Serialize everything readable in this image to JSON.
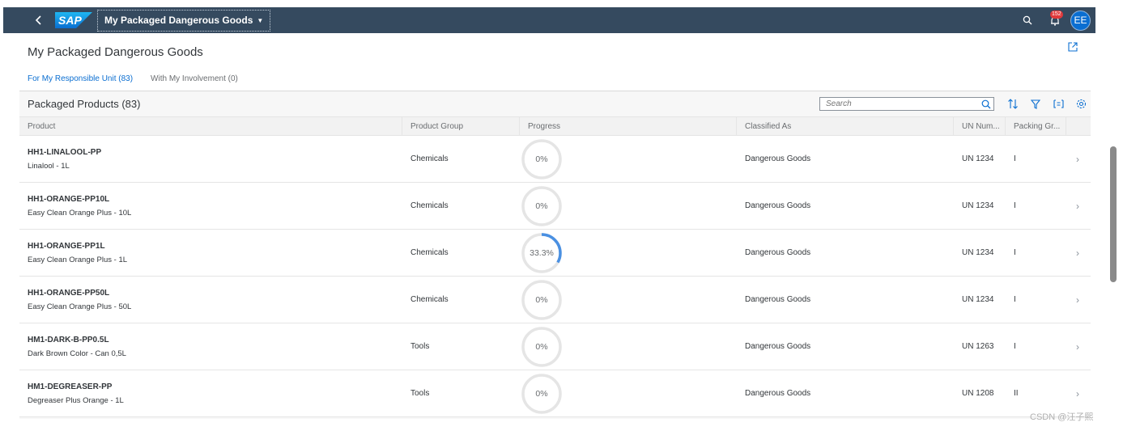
{
  "shell": {
    "title": "My Packaged Dangerous Goods",
    "logo_text": "SAP",
    "notification_count": "152",
    "avatar_initials": "EE"
  },
  "page": {
    "title": "My Packaged Dangerous Goods",
    "tabs": [
      {
        "label": "For My Responsible Unit (83)",
        "active": true
      },
      {
        "label": "With My Involvement (0)",
        "active": false
      }
    ]
  },
  "table": {
    "title": "Packaged Products (83)",
    "search_placeholder": "Search",
    "columns": [
      "Product",
      "Product Group",
      "Progress",
      "Classified As",
      "UN Num...",
      "Packing Gr..."
    ],
    "rows": [
      {
        "id": "HH1-LINALOOL-PP",
        "desc": "Linalool - 1L",
        "group": "Chemicals",
        "progress_label": "0%",
        "progress": 0,
        "classified": "Dangerous Goods",
        "un": "UN 1234",
        "packing": "I"
      },
      {
        "id": "HH1-ORANGE-PP10L",
        "desc": "Easy Clean Orange Plus - 10L",
        "group": "Chemicals",
        "progress_label": "0%",
        "progress": 0,
        "classified": "Dangerous Goods",
        "un": "UN 1234",
        "packing": "I"
      },
      {
        "id": "HH1-ORANGE-PP1L",
        "desc": "Easy Clean Orange Plus - 1L",
        "group": "Chemicals",
        "progress_label": "33.3%",
        "progress": 33.3,
        "classified": "Dangerous Goods",
        "un": "UN 1234",
        "packing": "I"
      },
      {
        "id": "HH1-ORANGE-PP50L",
        "desc": "Easy Clean Orange Plus - 50L",
        "group": "Chemicals",
        "progress_label": "0%",
        "progress": 0,
        "classified": "Dangerous Goods",
        "un": "UN 1234",
        "packing": "I"
      },
      {
        "id": "HM1-DARK-B-PP0.5L",
        "desc": "Dark Brown Color - Can 0,5L",
        "group": "Tools",
        "progress_label": "0%",
        "progress": 0,
        "classified": "Dangerous Goods",
        "un": "UN 1263",
        "packing": "I"
      },
      {
        "id": "HM1-DEGREASER-PP",
        "desc": "Degreaser Plus Orange - 1L",
        "group": "Tools",
        "progress_label": "0%",
        "progress": 0,
        "classified": "Dangerous Goods",
        "un": "UN 1208",
        "packing": "II"
      }
    ]
  },
  "watermark": "CSDN @汪子熙",
  "colors": {
    "shell_bg": "#354a5f",
    "accent": "#0a6ed1",
    "badge": "#e0393b",
    "ring_track": "#e5e5e5",
    "ring_fill": "#4a90e2"
  }
}
